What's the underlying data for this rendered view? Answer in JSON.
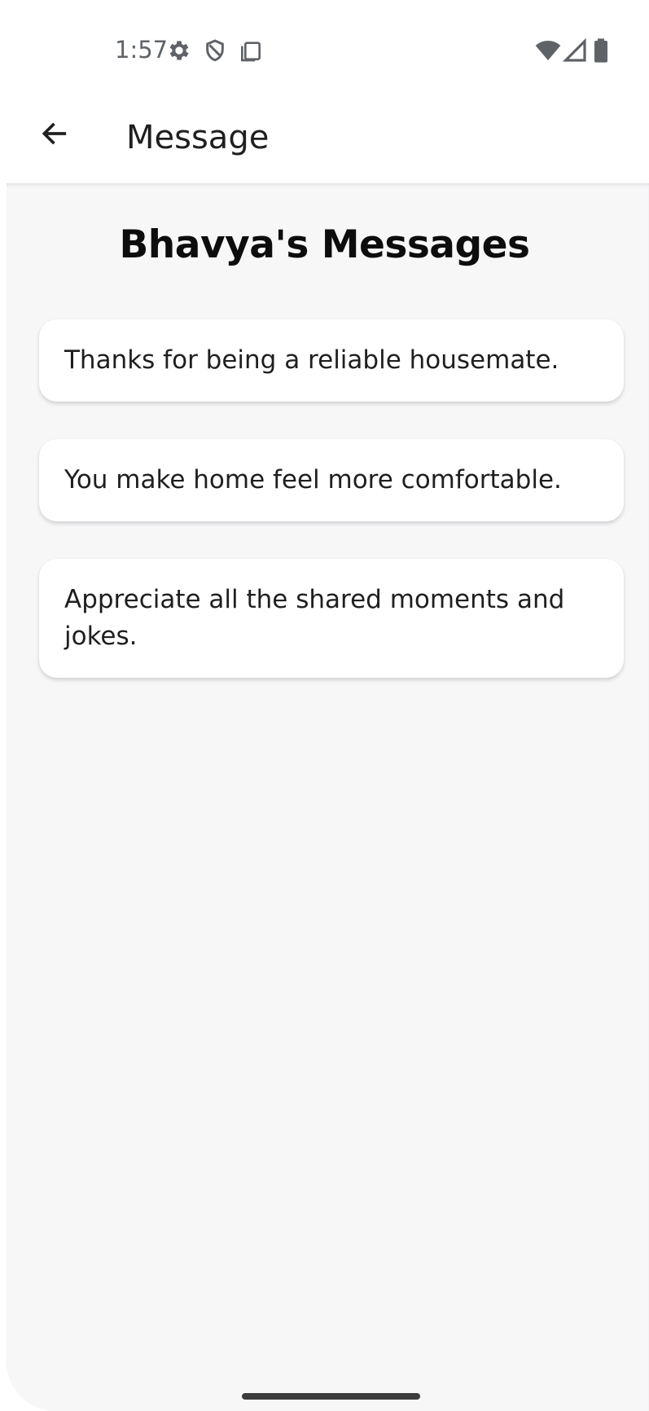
{
  "status_bar": {
    "time": "1:57",
    "icons": [
      "settings-icon",
      "shield-icon",
      "sim-card-icon",
      "wifi-icon",
      "signal-icon",
      "battery-icon"
    ]
  },
  "app_bar": {
    "back_icon": "arrow-left-icon",
    "title": "Message"
  },
  "page": {
    "heading": "Bhavya's Messages"
  },
  "messages": [
    {
      "text": "Thanks for being a reliable housemate."
    },
    {
      "text": "You make home feel more comfortable."
    },
    {
      "text": "Appreciate all the shared moments and jokes."
    }
  ],
  "colors": {
    "background": "#f7f7f8",
    "card": "#ffffff",
    "text": "#1f1f1f",
    "status_text": "#5f6368"
  }
}
